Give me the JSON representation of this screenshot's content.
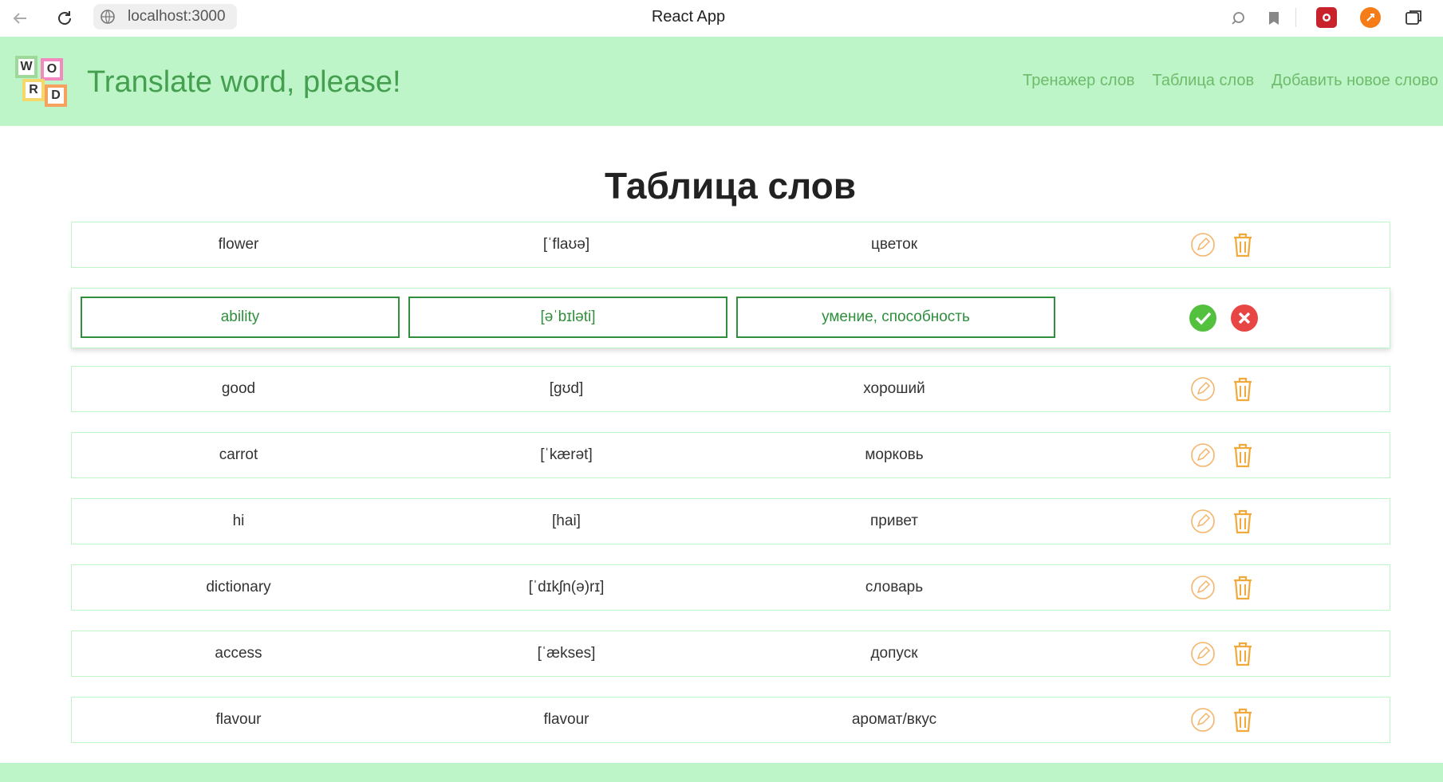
{
  "browser": {
    "url": "localhost:3000",
    "tab_title": "React App"
  },
  "header": {
    "logo_letters": [
      "W",
      "O",
      "R",
      "D"
    ],
    "title": "Translate word, please!",
    "nav": [
      {
        "label": "Тренажер слов"
      },
      {
        "label": "Таблица слов"
      },
      {
        "label": "Добавить новое слово"
      }
    ]
  },
  "main": {
    "title": "Таблица слов",
    "editing": {
      "word": "ability",
      "transcription": "[əˈbɪləti]",
      "translation": "умение, способность"
    },
    "words": [
      {
        "word": "flower",
        "transcription": "[ˈflaʊə]",
        "translation": "цветок"
      },
      {
        "word": "good",
        "transcription": "[gʊd]",
        "translation": "хороший"
      },
      {
        "word": "carrot",
        "transcription": "[ˈkærət]",
        "translation": "морковь"
      },
      {
        "word": "hi",
        "transcription": "[hai]",
        "translation": "привет"
      },
      {
        "word": "dictionary",
        "transcription": "[ˈdɪkʃn(ə)rɪ]",
        "translation": "словарь"
      },
      {
        "word": "access",
        "transcription": "[ˈækses]",
        "translation": "допуск"
      },
      {
        "word": "flavour",
        "transcription": "flavour",
        "translation": "аромат/вкус"
      }
    ]
  },
  "colors": {
    "header_bg": "#bdf5c8",
    "title_green": "#44a04f",
    "nav_green": "#6ebc6b",
    "edit_border": "#2f8f3c",
    "edit_icon_orange": "#f4b46a",
    "delete_icon_orange": "#f2a93b",
    "save_green": "#54c13e",
    "cancel_red": "#e84545"
  }
}
